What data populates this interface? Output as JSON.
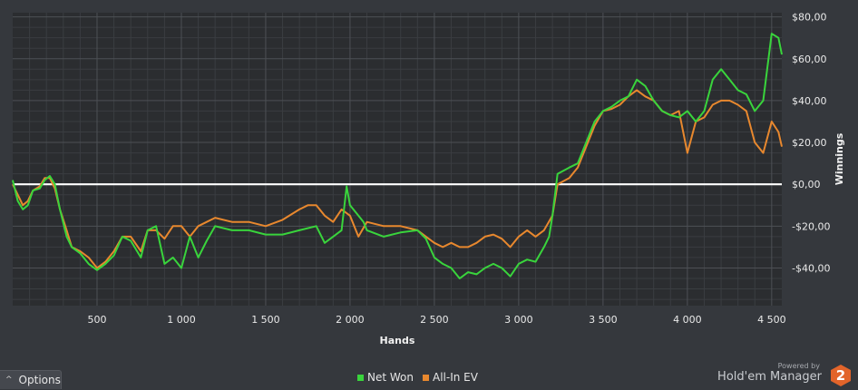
{
  "chart_data": {
    "type": "line",
    "xlabel": "Hands",
    "ylabel": "Winnings",
    "xlim": [
      0,
      4560
    ],
    "ylim": [
      -58,
      82
    ],
    "x_ticks": [
      {
        "value": 500,
        "label": "500"
      },
      {
        "value": 1000,
        "label": "1 000"
      },
      {
        "value": 1500,
        "label": "1 500"
      },
      {
        "value": 2000,
        "label": "2 000"
      },
      {
        "value": 2500,
        "label": "2 500"
      },
      {
        "value": 3000,
        "label": "3 000"
      },
      {
        "value": 3500,
        "label": "3 500"
      },
      {
        "value": 4000,
        "label": "4 000"
      },
      {
        "value": 4500,
        "label": "4 500"
      }
    ],
    "y_ticks": [
      {
        "value": 80,
        "label": "$80,00"
      },
      {
        "value": 60,
        "label": "$60,00"
      },
      {
        "value": 40,
        "label": "$40,00"
      },
      {
        "value": 20,
        "label": "$20,00"
      },
      {
        "value": 0,
        "label": "$0,00"
      },
      {
        "value": -20,
        "label": "-$20,00"
      },
      {
        "value": -40,
        "label": "-$40,00"
      }
    ],
    "grid": true,
    "zero_line": true,
    "legend_position": "bottom-center",
    "series": [
      {
        "name": "Net Won",
        "color": "#39d43c",
        "points": [
          [
            0,
            2
          ],
          [
            30,
            -8
          ],
          [
            60,
            -12
          ],
          [
            90,
            -10
          ],
          [
            120,
            -3
          ],
          [
            160,
            -2
          ],
          [
            190,
            2
          ],
          [
            220,
            4
          ],
          [
            250,
            0
          ],
          [
            280,
            -12
          ],
          [
            320,
            -25
          ],
          [
            350,
            -30
          ],
          [
            400,
            -33
          ],
          [
            450,
            -38
          ],
          [
            500,
            -41
          ],
          [
            550,
            -38
          ],
          [
            600,
            -34
          ],
          [
            650,
            -25
          ],
          [
            700,
            -27
          ],
          [
            760,
            -35
          ],
          [
            800,
            -22
          ],
          [
            850,
            -20
          ],
          [
            900,
            -38
          ],
          [
            950,
            -35
          ],
          [
            1000,
            -40
          ],
          [
            1050,
            -25
          ],
          [
            1100,
            -35
          ],
          [
            1150,
            -27
          ],
          [
            1200,
            -20
          ],
          [
            1300,
            -22
          ],
          [
            1400,
            -22
          ],
          [
            1500,
            -24
          ],
          [
            1600,
            -24
          ],
          [
            1700,
            -22
          ],
          [
            1800,
            -20
          ],
          [
            1850,
            -28
          ],
          [
            1900,
            -25
          ],
          [
            1950,
            -22
          ],
          [
            1980,
            -1
          ],
          [
            2000,
            -10
          ],
          [
            2050,
            -15
          ],
          [
            2080,
            -18
          ],
          [
            2100,
            -22
          ],
          [
            2200,
            -25
          ],
          [
            2300,
            -23
          ],
          [
            2400,
            -22
          ],
          [
            2450,
            -26
          ],
          [
            2500,
            -35
          ],
          [
            2550,
            -38
          ],
          [
            2600,
            -40
          ],
          [
            2650,
            -45
          ],
          [
            2700,
            -42
          ],
          [
            2750,
            -43
          ],
          [
            2800,
            -40
          ],
          [
            2850,
            -38
          ],
          [
            2900,
            -40
          ],
          [
            2950,
            -44
          ],
          [
            3000,
            -38
          ],
          [
            3050,
            -36
          ],
          [
            3100,
            -37
          ],
          [
            3150,
            -30
          ],
          [
            3180,
            -25
          ],
          [
            3200,
            -15
          ],
          [
            3230,
            5
          ],
          [
            3300,
            8
          ],
          [
            3350,
            10
          ],
          [
            3400,
            20
          ],
          [
            3450,
            30
          ],
          [
            3500,
            35
          ],
          [
            3550,
            37
          ],
          [
            3600,
            40
          ],
          [
            3650,
            42
          ],
          [
            3700,
            50
          ],
          [
            3750,
            47
          ],
          [
            3800,
            40
          ],
          [
            3850,
            35
          ],
          [
            3900,
            33
          ],
          [
            3950,
            32
          ],
          [
            4000,
            35
          ],
          [
            4050,
            30
          ],
          [
            4100,
            35
          ],
          [
            4150,
            50
          ],
          [
            4200,
            55
          ],
          [
            4250,
            50
          ],
          [
            4300,
            45
          ],
          [
            4350,
            43
          ],
          [
            4400,
            35
          ],
          [
            4450,
            40
          ],
          [
            4500,
            72
          ],
          [
            4540,
            70
          ],
          [
            4560,
            62
          ]
        ]
      },
      {
        "name": "All-In EV",
        "color": "#e8882e",
        "points": [
          [
            0,
            0
          ],
          [
            30,
            -5
          ],
          [
            60,
            -10
          ],
          [
            90,
            -8
          ],
          [
            120,
            -3
          ],
          [
            160,
            -1
          ],
          [
            190,
            3
          ],
          [
            220,
            3
          ],
          [
            250,
            -2
          ],
          [
            280,
            -12
          ],
          [
            320,
            -22
          ],
          [
            350,
            -30
          ],
          [
            400,
            -32
          ],
          [
            450,
            -35
          ],
          [
            500,
            -40
          ],
          [
            550,
            -37
          ],
          [
            600,
            -32
          ],
          [
            650,
            -25
          ],
          [
            700,
            -25
          ],
          [
            760,
            -32
          ],
          [
            800,
            -22
          ],
          [
            850,
            -22
          ],
          [
            900,
            -26
          ],
          [
            950,
            -20
          ],
          [
            1000,
            -20
          ],
          [
            1050,
            -25
          ],
          [
            1100,
            -20
          ],
          [
            1150,
            -18
          ],
          [
            1200,
            -16
          ],
          [
            1300,
            -18
          ],
          [
            1400,
            -18
          ],
          [
            1500,
            -20
          ],
          [
            1600,
            -17
          ],
          [
            1700,
            -12
          ],
          [
            1750,
            -10
          ],
          [
            1800,
            -10
          ],
          [
            1850,
            -15
          ],
          [
            1900,
            -18
          ],
          [
            1950,
            -12
          ],
          [
            2000,
            -15
          ],
          [
            2050,
            -25
          ],
          [
            2100,
            -18
          ],
          [
            2200,
            -20
          ],
          [
            2300,
            -20
          ],
          [
            2400,
            -22
          ],
          [
            2500,
            -28
          ],
          [
            2550,
            -30
          ],
          [
            2600,
            -28
          ],
          [
            2650,
            -30
          ],
          [
            2700,
            -30
          ],
          [
            2750,
            -28
          ],
          [
            2800,
            -25
          ],
          [
            2850,
            -24
          ],
          [
            2900,
            -26
          ],
          [
            2950,
            -30
          ],
          [
            3000,
            -25
          ],
          [
            3050,
            -22
          ],
          [
            3100,
            -25
          ],
          [
            3150,
            -22
          ],
          [
            3200,
            -15
          ],
          [
            3230,
            0
          ],
          [
            3300,
            3
          ],
          [
            3350,
            8
          ],
          [
            3400,
            18
          ],
          [
            3450,
            28
          ],
          [
            3500,
            35
          ],
          [
            3550,
            36
          ],
          [
            3600,
            38
          ],
          [
            3650,
            42
          ],
          [
            3700,
            45
          ],
          [
            3750,
            42
          ],
          [
            3800,
            40
          ],
          [
            3850,
            35
          ],
          [
            3900,
            33
          ],
          [
            3950,
            35
          ],
          [
            4000,
            15
          ],
          [
            4050,
            30
          ],
          [
            4100,
            32
          ],
          [
            4150,
            38
          ],
          [
            4200,
            40
          ],
          [
            4250,
            40
          ],
          [
            4300,
            38
          ],
          [
            4350,
            35
          ],
          [
            4400,
            20
          ],
          [
            4450,
            15
          ],
          [
            4500,
            30
          ],
          [
            4540,
            25
          ],
          [
            4560,
            18
          ]
        ]
      }
    ]
  },
  "options": {
    "label": "Options",
    "caret": "^"
  },
  "legend": {
    "items": [
      {
        "label": "Net Won",
        "color": "#39d43c"
      },
      {
        "label": "All-In EV",
        "color": "#e8882e"
      }
    ]
  },
  "branding": {
    "powered_by": "Powered by",
    "name": "Hold'em Manager",
    "badge": "2"
  }
}
